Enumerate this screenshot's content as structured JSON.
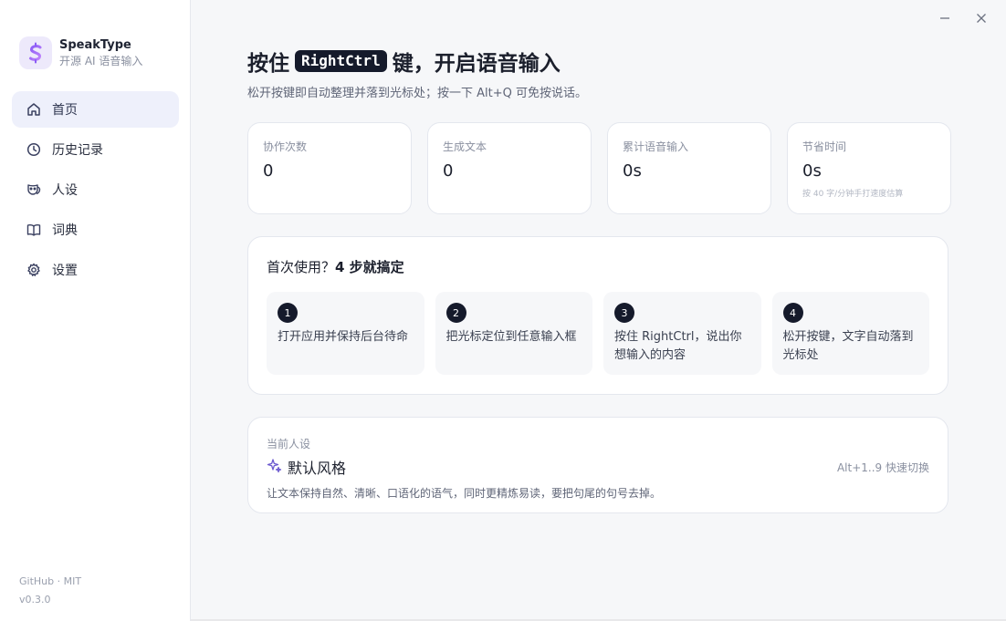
{
  "brand": {
    "name": "SpeakType",
    "subtitle": "开源 AI 语音输入"
  },
  "nav": [
    {
      "label": "首页",
      "icon": "home-icon",
      "active": true
    },
    {
      "label": "历史记录",
      "icon": "clock-icon",
      "active": false
    },
    {
      "label": "人设",
      "icon": "mask-icon",
      "active": false
    },
    {
      "label": "词典",
      "icon": "book-icon",
      "active": false
    },
    {
      "label": "设置",
      "icon": "gear-icon",
      "active": false
    }
  ],
  "footer": {
    "links": "GitHub · MIT",
    "version": "v0.3.0"
  },
  "hero": {
    "title_prefix": "按住",
    "key": "RightCtrl",
    "title_suffix": "键，开启语音输入",
    "subtitle": "松开按键即自动整理并落到光标处；按一下 Alt+Q 可免按说话。"
  },
  "stats": [
    {
      "label": "协作次数",
      "value": "0",
      "note": ""
    },
    {
      "label": "生成文本",
      "value": "0",
      "note": ""
    },
    {
      "label": "累计语音输入",
      "value": "0s",
      "note": ""
    },
    {
      "label": "节省时间",
      "value": "0s",
      "note": "按 40 字/分钟手打速度估算"
    }
  ],
  "steps": {
    "title_prefix": "首次使用？",
    "title_strong": "4 步就搞定",
    "items": [
      {
        "num": "1",
        "text": "打开应用并保持后台待命"
      },
      {
        "num": "2",
        "text": "把光标定位到任意输入框"
      },
      {
        "num": "3",
        "text": "按住 RightCtrl，说出你想输入的内容"
      },
      {
        "num": "4",
        "text": "松开按键，文字自动落到光标处"
      }
    ]
  },
  "persona": {
    "label": "当前人设",
    "name": "默认风格",
    "shortcut": "Alt+1..9 快速切换",
    "description": "让文本保持自然、清晰、口语化的语气，同时更精炼易读，要把句尾的句号去掉。"
  },
  "colors": {
    "accent": "#8b5cf6",
    "active_nav_bg": "#eef0fb",
    "dark": "#151a2b"
  }
}
